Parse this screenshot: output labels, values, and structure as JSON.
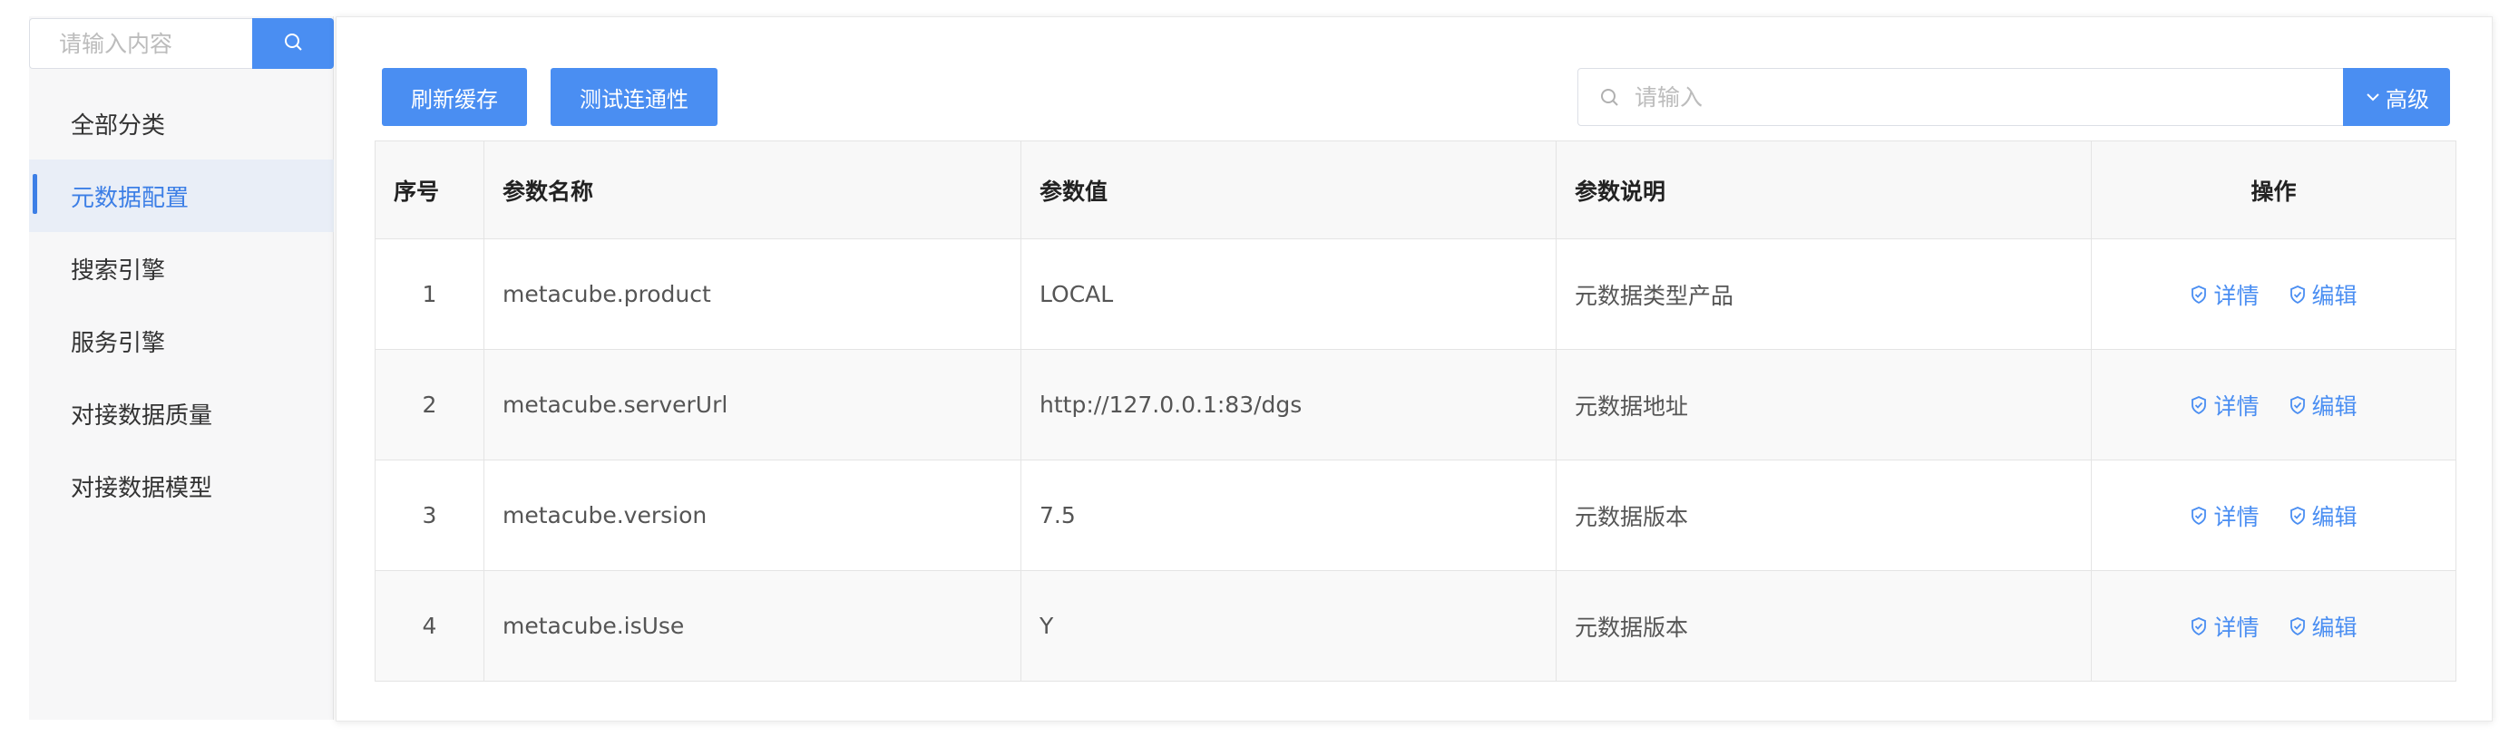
{
  "sidebar": {
    "search_placeholder": "请输入内容",
    "items": [
      {
        "label": "全部分类",
        "active": false
      },
      {
        "label": "元数据配置",
        "active": true
      },
      {
        "label": "搜索引擎",
        "active": false
      },
      {
        "label": "服务引擎",
        "active": false
      },
      {
        "label": "对接数据质量",
        "active": false
      },
      {
        "label": "对接数据模型",
        "active": false
      }
    ]
  },
  "toolbar": {
    "refresh_label": "刷新缓存",
    "test_label": "测试连通性",
    "search_placeholder": "请输入",
    "advanced_label": "高级"
  },
  "table": {
    "headers": {
      "index": "序号",
      "name": "参数名称",
      "value": "参数值",
      "desc": "参数说明",
      "ops": "操作"
    },
    "rows": [
      {
        "index": "1",
        "name": "metacube.product",
        "value": "LOCAL",
        "desc": "元数据类型产品",
        "detail": "详情",
        "edit": "编辑"
      },
      {
        "index": "2",
        "name": "metacube.serverUrl",
        "value": "http://127.0.0.1:83/dgs",
        "desc": "元数据地址",
        "detail": "详情",
        "edit": "编辑"
      },
      {
        "index": "3",
        "name": "metacube.version",
        "value": "7.5",
        "desc": "元数据版本",
        "detail": "详情",
        "edit": "编辑"
      },
      {
        "index": "4",
        "name": "metacube.isUse",
        "value": "Y",
        "desc": "元数据版本",
        "detail": "详情",
        "edit": "编辑"
      }
    ]
  },
  "colors": {
    "accent": "#4a8ef2",
    "active_bg": "#e9eef7",
    "active_text": "#3d7fe6"
  },
  "icons": {
    "sidebar_search": "search-icon",
    "top_search": "search-icon",
    "advanced": "chevron-down-icon",
    "detail": "shield-check-icon",
    "edit": "shield-check-icon"
  }
}
